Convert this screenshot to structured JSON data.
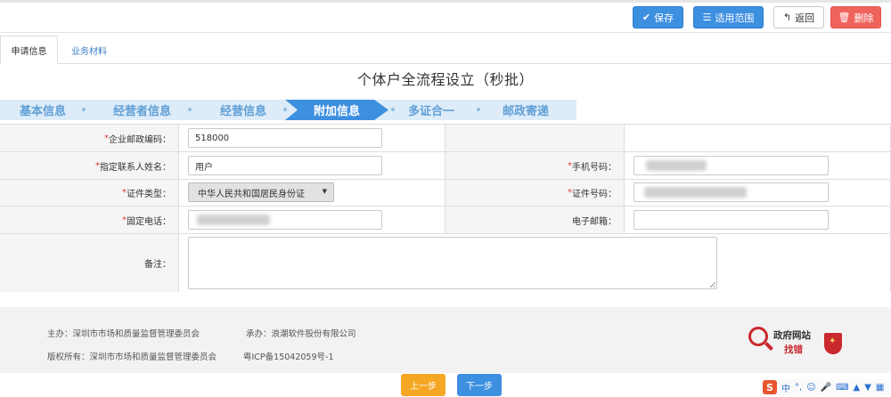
{
  "toolbar": {
    "save_label": "保存",
    "scope_label": "适用范围",
    "back_label": "返回",
    "delete_label": "删除"
  },
  "tabs": [
    {
      "label": "申请信息",
      "active": true
    },
    {
      "label": "业务材料",
      "active": false
    }
  ],
  "page_title": "个体户全流程设立（秒批）",
  "steps": [
    {
      "label": "基本信息",
      "active": false
    },
    {
      "label": "经营者信息",
      "active": false
    },
    {
      "label": "经营信息",
      "active": false
    },
    {
      "label": "附加信息",
      "active": true
    },
    {
      "label": "多证合一",
      "active": false
    },
    {
      "label": "邮政寄递",
      "active": false
    }
  ],
  "form": {
    "postal_code": {
      "label": "企业邮政编码：",
      "required": true,
      "value": "518000"
    },
    "contact_name": {
      "label": "指定联系人姓名：",
      "required": true,
      "value": "用户"
    },
    "mobile": {
      "label": "手机号码：",
      "required": true,
      "value": ""
    },
    "id_type": {
      "label": "证件类型：",
      "required": true,
      "value": "中华人民共和国居民身份证"
    },
    "id_number": {
      "label": "证件号码：",
      "required": true,
      "value": ""
    },
    "landline": {
      "label": "固定电话：",
      "required": true,
      "value": ""
    },
    "email": {
      "label": "电子邮箱：",
      "required": false,
      "value": ""
    },
    "remarks": {
      "label": "备注：",
      "required": false,
      "value": ""
    }
  },
  "footer": {
    "host": "主办：深圳市市场和质量监督管理委员会",
    "contractor": "承办：浪潮软件股份有限公司",
    "copyright": "版权所有：深圳市市场和质量监督管理委员会",
    "icp": "粤ICP备15042059号-1",
    "gov_badge_line1": "政府网站",
    "gov_badge_line2": "找错"
  },
  "nav": {
    "prev_label": "上一步",
    "next_label": "下一步"
  },
  "ime": {
    "logo": "S",
    "mode": "中"
  },
  "colors": {
    "primary": "#3d8fe0",
    "danger": "#f0635d",
    "warning": "#f5a623",
    "required": "#e4393c",
    "step_bg": "#ddecf8"
  }
}
